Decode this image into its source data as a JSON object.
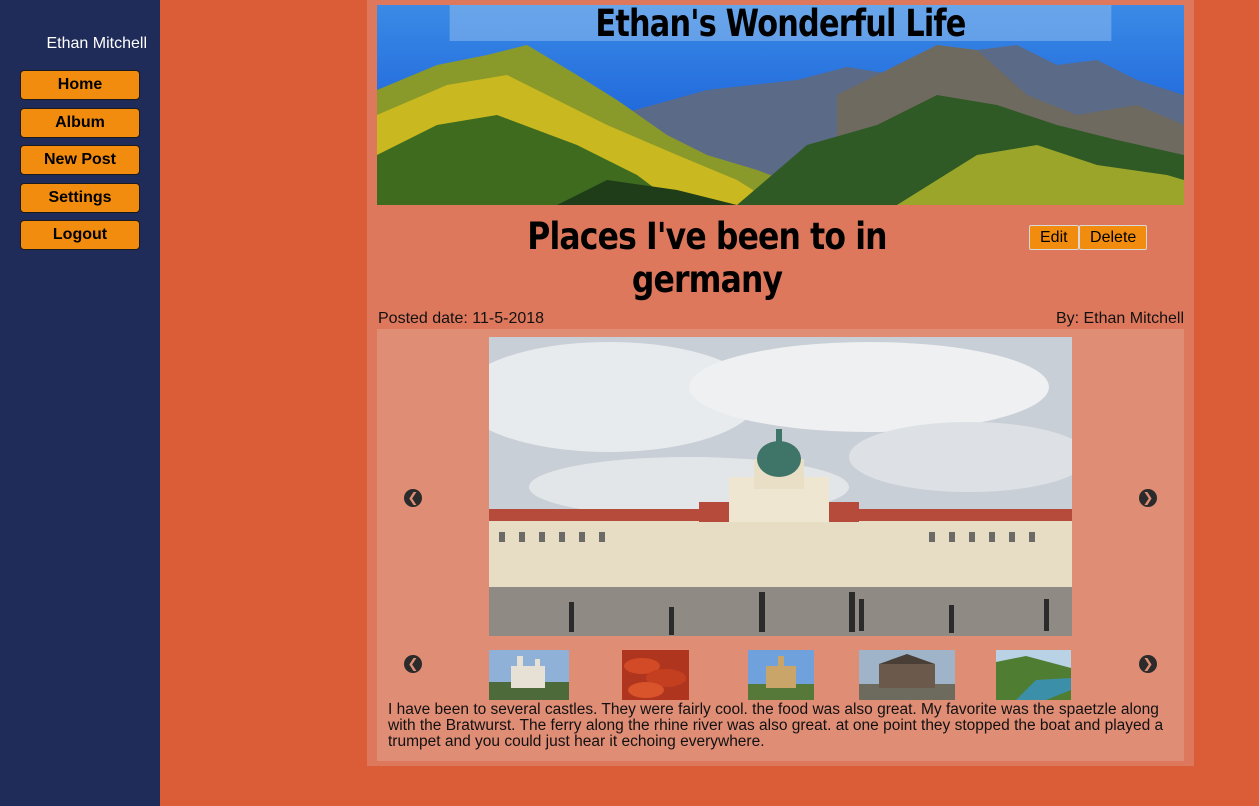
{
  "sidebar": {
    "username": "Ethan Mitchell",
    "nav": [
      "Home",
      "Album",
      "New Post",
      "Settings",
      "Logout"
    ]
  },
  "blog": {
    "title": "Ethan's Wonderful Life"
  },
  "post": {
    "title": "Places I've been to in germany",
    "edit_label": "Edit",
    "delete_label": "Delete",
    "posted_date": "Posted date: 11-5-2018",
    "author": "By: Ethan Mitchell",
    "description": "I have been to several castles. They were fairly cool. the food was also great. My favorite was the spaetzle along with the Bratwurst. The ferry along the rhine river was also great. at one point they stopped the boat and played a trumpet and you could just hear it echoing everywhere."
  },
  "gallery": {
    "prev_icon": "chevron-left-icon",
    "next_icon": "chevron-right-icon",
    "main_image": "palace",
    "thumbnails": [
      "castle-1",
      "sausages",
      "castle-2",
      "manor",
      "river"
    ]
  },
  "colors": {
    "page_bg": "#db5d37",
    "sidebar_bg": "#1f2b58",
    "card_bg": "#de785c",
    "gallery_bg": "#e08d76",
    "button_bg": "#f28c0f"
  }
}
